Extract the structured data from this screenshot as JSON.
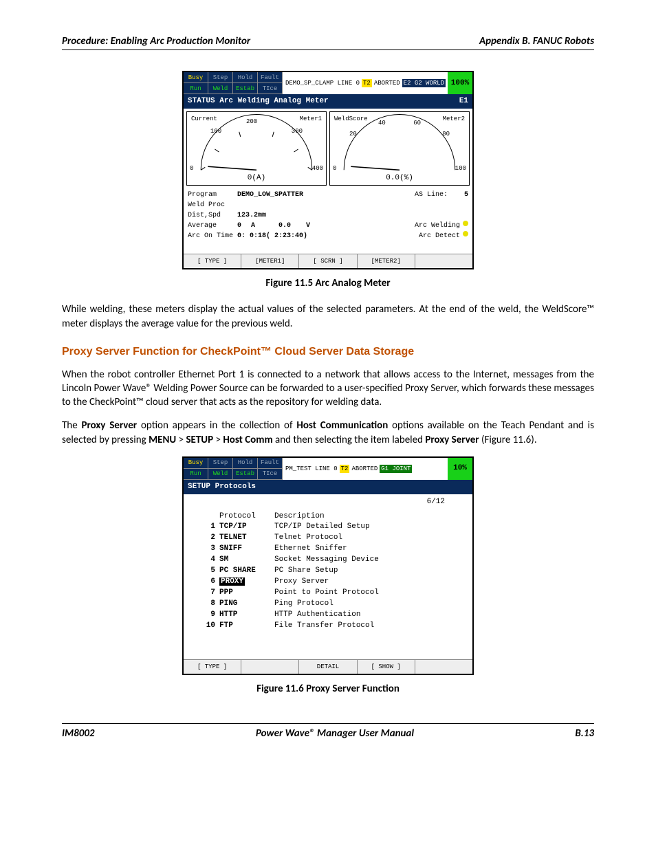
{
  "header": {
    "left": "Procedure: Enabling Arc Production Monitor",
    "right": "Appendix B. FANUC Robots"
  },
  "footer": {
    "left": "IM8002",
    "center": "Power Wave® Manager User Manual",
    "right": "B.13"
  },
  "fig1": {
    "status_cells": [
      "Busy",
      "Step",
      "Hold",
      "Fault",
      "Run",
      "Weld",
      "Estab",
      "TIce"
    ],
    "status_text": "DEMO_SP_CLAMP LINE 0",
    "t2": "T2",
    "aborted": "ABORTED",
    "chip2": "E2 G2 WORLD",
    "pct": "100%",
    "bluebar_left": "STATUS Arc Welding Analog Meter",
    "bluebar_right": "E1",
    "meter1": {
      "title": "Current",
      "ticks": [
        "0",
        "100",
        "200",
        "300",
        "400"
      ],
      "label": "Meter1",
      "reading": "0(A)"
    },
    "meter2": {
      "title": "WeldScore",
      "ticks": [
        "0",
        "20",
        "40",
        "60",
        "80",
        "100"
      ],
      "label": "Meter2",
      "reading": "0.0(%)"
    },
    "info": {
      "program_lbl": "Program",
      "program_val": "DEMO_LOW_SPATTER",
      "asline_lbl": "AS Line:",
      "asline_val": "5",
      "weldproc_lbl": "Weld Proc",
      "dist_lbl": "Dist,Spd",
      "dist_val": "123.2mm",
      "avg_lbl": "Average",
      "avg_a": "0",
      "avg_a_unit": "A",
      "avg_v": "0.0",
      "avg_v_unit": "V",
      "arc_welding": "Arc Welding",
      "arc_on_lbl": "Arc On Time",
      "arc_on_val": "0: 0:18( 2:23:40)",
      "arc_detect": "Arc Detect"
    },
    "buttons": [
      "[ TYPE ]",
      "[METER1]",
      "[ SCRN ]",
      "[METER2]",
      ""
    ],
    "caption": "Figure 11.5   Arc Analog Meter"
  },
  "para1": "While welding, these meters display the actual values of the selected parameters.  At the end of the weld, the WeldScore™ meter displays the average value for the previous weld.",
  "section_title": "Proxy Server Function for CheckPoint™ Cloud Server Data Storage",
  "para2": "When the robot controller Ethernet Port 1 is connected to a network that allows access to the Internet, messages from the Lincoln Power Wave® Welding Power Source can be forwarded to a user-specified Proxy Server, which forwards these messages to the CheckPoint™ cloud server that acts as the repository for welding data.",
  "para3": {
    "pre": "The ",
    "b1": "Proxy Server",
    "t1": " option appears in the collection of ",
    "b2": "Host Communication",
    "t2": " options available on the Teach Pendant and is selected by pressing ",
    "b3": "MENU",
    "gt1": " > ",
    "b4": "SETUP",
    "gt2": " > ",
    "b5": "Host Comm",
    "t3": " and then selecting the item labeled ",
    "b6": "Proxy Server",
    "t4": " (Figure 11.6)."
  },
  "fig2": {
    "status_cells": [
      "Busy",
      "Step",
      "Hold",
      "Fault",
      "Run",
      "Weld",
      "Estab",
      "TIce"
    ],
    "status_text": "PM_TEST LINE 0",
    "t2": "T2",
    "aborted": "ABORTED",
    "chip2": "G1 JOINT",
    "pct": "10%",
    "bluebar": "SETUP Protocols",
    "count": "6/12",
    "head_proto": "Protocol",
    "head_desc": "Description",
    "rows": [
      {
        "n": "1",
        "code": "TCP/IP",
        "desc": "TCP/IP Detailed Setup"
      },
      {
        "n": "2",
        "code": "TELNET",
        "desc": "Telnet Protocol"
      },
      {
        "n": "3",
        "code": "SNIFF",
        "desc": "Ethernet Sniffer"
      },
      {
        "n": "4",
        "code": "SM",
        "desc": "Socket Messaging Device"
      },
      {
        "n": "5",
        "code": "PC SHARE",
        "desc": "PC Share Setup"
      },
      {
        "n": "6",
        "code": "PROXY",
        "desc": "Proxy Server",
        "sel": true
      },
      {
        "n": "7",
        "code": "PPP",
        "desc": "Point to Point Protocol"
      },
      {
        "n": "8",
        "code": "PING",
        "desc": "Ping Protocol"
      },
      {
        "n": "9",
        "code": "HTTP",
        "desc": "HTTP Authentication"
      },
      {
        "n": "10",
        "code": "FTP",
        "desc": "File Transfer Protocol"
      }
    ],
    "buttons": [
      "[ TYPE ]",
      "",
      "DETAIL",
      "[ SHOW ]",
      ""
    ],
    "caption": "Figure 11.6   Proxy Server Function"
  }
}
